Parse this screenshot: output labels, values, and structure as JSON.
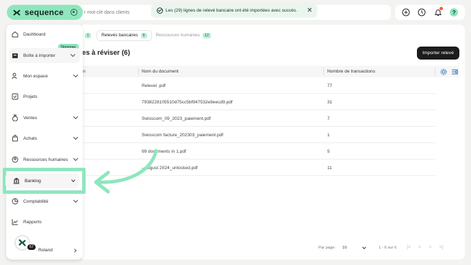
{
  "brand": {
    "name": "sequence"
  },
  "search": {
    "placeholder": "r mot-clé dans clients"
  },
  "toast": {
    "message": "Les (29) lignes de relevé bancaire ont été importées avec succès.",
    "close": "✕"
  },
  "tabs": [
    {
      "label": "",
      "count": "1"
    },
    {
      "label": "Relevés bancaires",
      "count": "6"
    },
    {
      "label": "Ressources humaines",
      "count": "12"
    }
  ],
  "section": {
    "title": "res à réviser (6)"
  },
  "actions": {
    "import_label": "Importer relevé"
  },
  "table": {
    "headers": {
      "ext": "ion",
      "doc": "Nom du document",
      "count": "Nombre de transactions"
    },
    "rows": [
      {
        "doc": "Relevel    .pdf",
        "count": "77"
      },
      {
        "doc": "7938228105510d75cc5bf947532e8eecd9.pdf",
        "count": "31"
      },
      {
        "doc": "Swisscom_09_2023_paiement.pdf",
        "count": "7"
      },
      {
        "doc": "Swisscom facture_202303_paiement.pdf",
        "count": "1"
      },
      {
        "doc": "99 documents in 1.pdf",
        "count": "5"
      },
      {
        "doc": "- August 2024_unlocked.pdf",
        "count": "11"
      }
    ]
  },
  "pager": {
    "label": "Par page:",
    "per_page": "10",
    "range": "1 - 6 sur 6",
    "first": "|<",
    "prev": "<",
    "next": ">",
    "last": ">|"
  },
  "sidebar": {
    "items": [
      {
        "label": "Dashboard"
      },
      {
        "label": "Boîte à importer"
      },
      {
        "label": "Mon espace"
      },
      {
        "label": "Projets"
      },
      {
        "label": "Ventes"
      },
      {
        "label": "Achats"
      },
      {
        "label": "Ressources humaines"
      },
      {
        "label": "Banking"
      },
      {
        "label": "Comptabilité"
      },
      {
        "label": "Rapports"
      }
    ],
    "new_badge": "Nouveau",
    "user": {
      "name": "Roland",
      "badge": "57"
    }
  },
  "colors": {
    "accent": "#8fe6be",
    "dark": "#1c1c1c",
    "notification": "#ff5a3c"
  }
}
